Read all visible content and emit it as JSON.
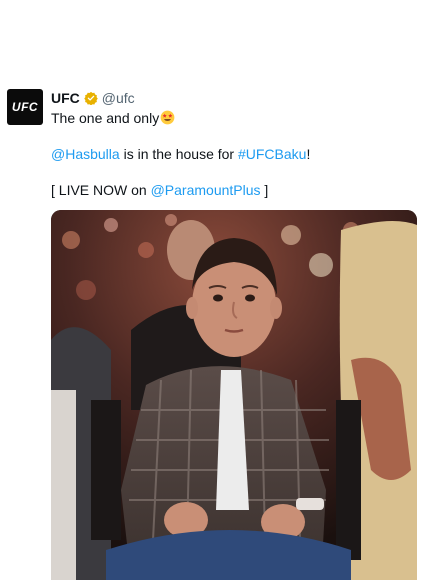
{
  "account": {
    "avatar_text": "UFC",
    "name": "UFC",
    "handle": "@ufc",
    "verified_icon": "gold-verified-badge"
  },
  "tweet": {
    "line1_text": "The one and only",
    "line1_emoji": "star-struck-emoji",
    "line2_mention": "@Hasbulla",
    "line2_middle": " is in the house for ",
    "line2_hashtag": "#UFCBaku",
    "line2_end": "!",
    "line3_start": "[ LIVE NOW on ",
    "line3_mention": "@ParamountPlus",
    "line3_end": " ]"
  },
  "media": {
    "type": "photo"
  },
  "colors": {
    "link": "#1d9bf0",
    "verified": "#e8b100",
    "text": "#0f1419",
    "handle": "#536471"
  }
}
